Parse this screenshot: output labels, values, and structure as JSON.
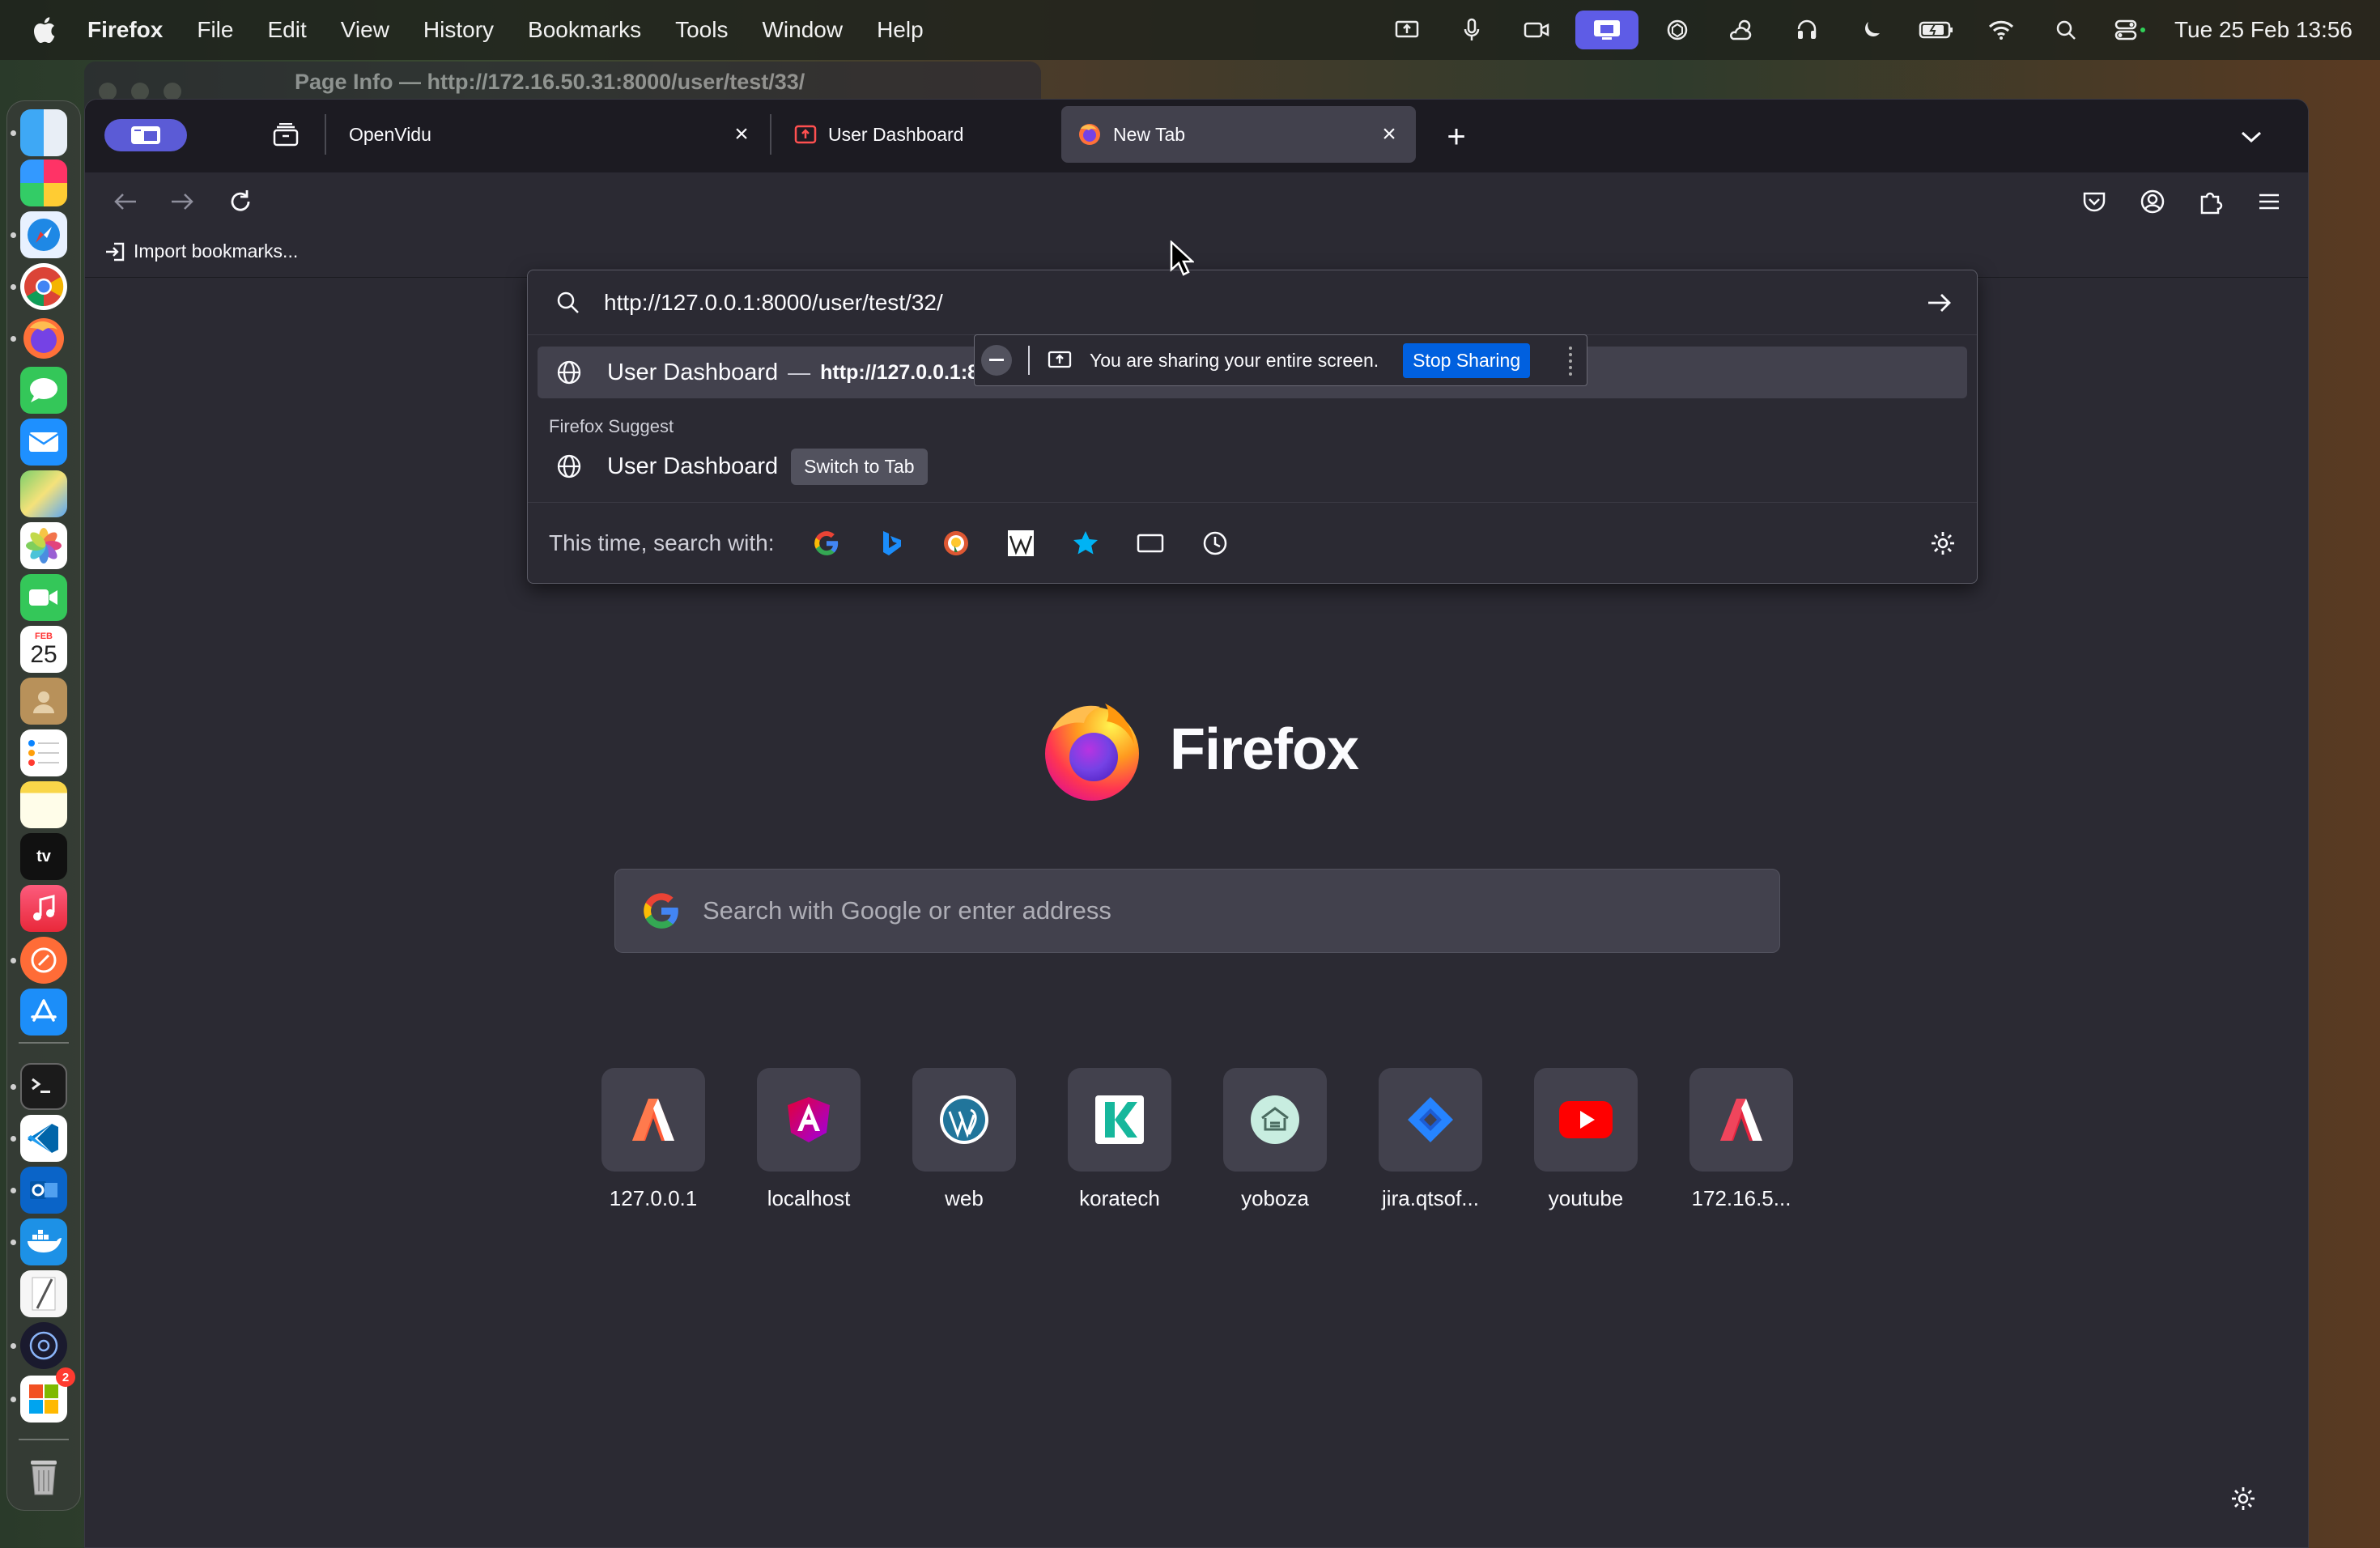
{
  "menubar": {
    "app_name": "Firefox",
    "items": [
      "File",
      "Edit",
      "View",
      "History",
      "Bookmarks",
      "Tools",
      "Window",
      "Help"
    ],
    "clock": "Tue 25 Feb  13:56",
    "status_icons": [
      "screen-share-icon",
      "microphone-icon",
      "camera-icon",
      "screen-mirroring-icon",
      "openai-icon",
      "weather-icon",
      "airpods-icon",
      "focus-moon-icon",
      "battery-icon",
      "wifi-icon",
      "spotlight-icon",
      "control-center-icon"
    ]
  },
  "dock": {
    "apps": [
      "Finder",
      "Launchpad",
      "Safari",
      "Chrome",
      "Firefox",
      "Messages",
      "Mail",
      "Maps",
      "Photos",
      "FaceTime",
      "Calendar",
      "Contacts",
      "Reminders",
      "Notes",
      "TV",
      "Music",
      "Postman",
      "App Store",
      "Terminal",
      "VS Code",
      "Outlook",
      "Docker",
      "TextEdit",
      "Screenshot",
      "Microsoft 365",
      "Trash"
    ],
    "calendar_day": "25",
    "calendar_month": "FEB",
    "badge_count": "2"
  },
  "behind_window": {
    "title": "Page Info — http://172.16.50.31:8000/user/test/33/"
  },
  "tabs": [
    {
      "title": "OpenVidu",
      "favicon": "none"
    },
    {
      "title": "User Dashboard",
      "favicon": "screen-share-red-icon"
    },
    {
      "title": "New Tab",
      "favicon": "firefox-icon",
      "selected": true
    }
  ],
  "bookmarks_bar": {
    "import_label": "Import bookmarks..."
  },
  "urlbar": {
    "value": "http://127.0.0.1:8000/user/test/32/",
    "results": {
      "first": {
        "title": "User Dashboard",
        "separator": "—",
        "url": "http://127.0.0.1:8"
      },
      "suggest_heading": "Firefox Suggest",
      "second": {
        "title": "User Dashboard",
        "action": "Switch to Tab"
      }
    },
    "one_offs_label": "This time, search with:",
    "one_off_engines": [
      "google-icon",
      "bing-icon",
      "duckduckgo-icon",
      "wikipedia-icon",
      "bookmarks-star-icon",
      "tabs-icon",
      "history-clock-icon"
    ]
  },
  "sharing": {
    "text": "You are sharing your entire screen.",
    "stop_label": "Stop Sharing"
  },
  "newtab": {
    "wordmark": "Firefox",
    "search_placeholder": "Search with Google or enter address",
    "top_sites": [
      {
        "label": "127.0.0.1",
        "icon": "orange-a-icon"
      },
      {
        "label": "localhost",
        "icon": "angular-icon"
      },
      {
        "label": "web",
        "icon": "wordpress-icon"
      },
      {
        "label": "koratech",
        "icon": "koratech-k-icon"
      },
      {
        "label": "yoboza",
        "icon": "yoboza-icon"
      },
      {
        "label": "jira.qtsof...",
        "icon": "jira-icon"
      },
      {
        "label": "youtube",
        "icon": "youtube-icon"
      },
      {
        "label": "172.16.5...",
        "icon": "red-a-icon"
      }
    ]
  },
  "colors": {
    "accent_blue": "#0060df",
    "tab_selected": "#42414d",
    "toolbar": "#2b2a33",
    "frame": "#1c1b22",
    "sidebar_toggle": "#5b5bd6"
  }
}
